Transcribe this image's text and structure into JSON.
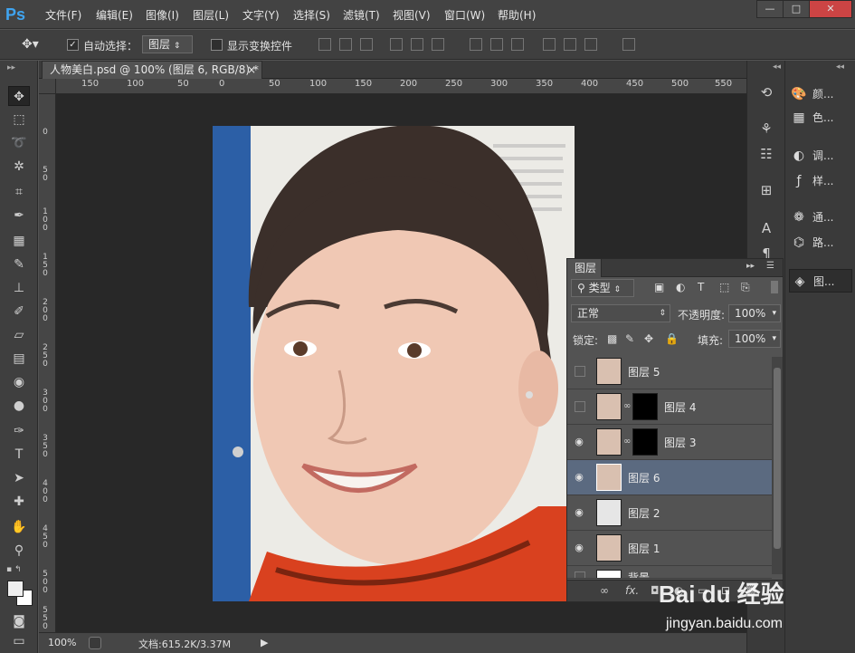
{
  "app": {
    "logo": "Ps"
  },
  "menu": [
    "文件(F)",
    "编辑(E)",
    "图像(I)",
    "图层(L)",
    "文字(Y)",
    "选择(S)",
    "滤镜(T)",
    "视图(V)",
    "窗口(W)",
    "帮助(H)"
  ],
  "window_controls": {
    "minimize": "—",
    "maximize": "□",
    "close": "✕"
  },
  "options": {
    "auto_select_label": "自动选择：",
    "auto_select_value": "图层",
    "show_transform_label": "显示变换控件"
  },
  "document": {
    "tab_title": "人物美白.psd @ 100% (图层 6, RGB/8) *",
    "tab_close": "×",
    "zoom": "100%",
    "doc_info": "文档:615.2K/3.37M"
  },
  "ruler": {
    "h_labels": [
      "150",
      "100",
      "50",
      "0",
      "50",
      "100",
      "150",
      "200",
      "250",
      "300",
      "350",
      "400",
      "450",
      "500",
      "550"
    ],
    "v_labels": [
      "0",
      "5\n0",
      "1\n0\n0",
      "1\n5\n0",
      "2\n0\n0",
      "2\n5\n0",
      "3\n0\n0",
      "3\n5\n0",
      "4\n0\n0",
      "4\n5\n0",
      "5\n0\n0",
      "5\n5\n0"
    ]
  },
  "right_dock": {
    "items": [
      {
        "icon": "palette-icon",
        "label": "颜..."
      },
      {
        "icon": "swatches-icon",
        "label": "色..."
      },
      {
        "icon": "adjustments-icon",
        "label": "调..."
      },
      {
        "icon": "styles-icon",
        "label": "样..."
      },
      {
        "icon": "channels-icon",
        "label": "通..."
      },
      {
        "icon": "paths-icon",
        "label": "路..."
      },
      {
        "icon": "layers-icon",
        "label": "图..."
      }
    ]
  },
  "layers_panel": {
    "title": "图层",
    "filter_kind": "类型",
    "blend_mode": "正常",
    "opacity_label": "不透明度:",
    "opacity_value": "100%",
    "lock_label": "锁定:",
    "fill_label": "填充:",
    "fill_value": "100%",
    "layers": [
      {
        "name": "图层 5",
        "visible": false,
        "mask": false,
        "selected": false
      },
      {
        "name": "图层 4",
        "visible": false,
        "mask": true,
        "selected": false
      },
      {
        "name": "图层 3",
        "visible": true,
        "mask": true,
        "selected": false
      },
      {
        "name": "图层 6",
        "visible": true,
        "mask": false,
        "selected": true
      },
      {
        "name": "图层 2",
        "visible": true,
        "mask": false,
        "selected": false
      },
      {
        "name": "图层 1",
        "visible": true,
        "mask": false,
        "selected": false
      },
      {
        "name": "背景",
        "visible": false,
        "mask": false,
        "selected": false
      }
    ],
    "footer_icons": [
      "link-icon",
      "fx-icon",
      "mask-icon",
      "adjustment-icon",
      "folder-icon",
      "new-layer-icon",
      "trash-icon"
    ],
    "footer_fx": "fx."
  },
  "watermark": {
    "brand": "Bai du 经验",
    "url": "jingyan.baidu.com"
  },
  "colors": {
    "accent": "#3fa4f0",
    "selected_layer": "#5b6a80"
  }
}
